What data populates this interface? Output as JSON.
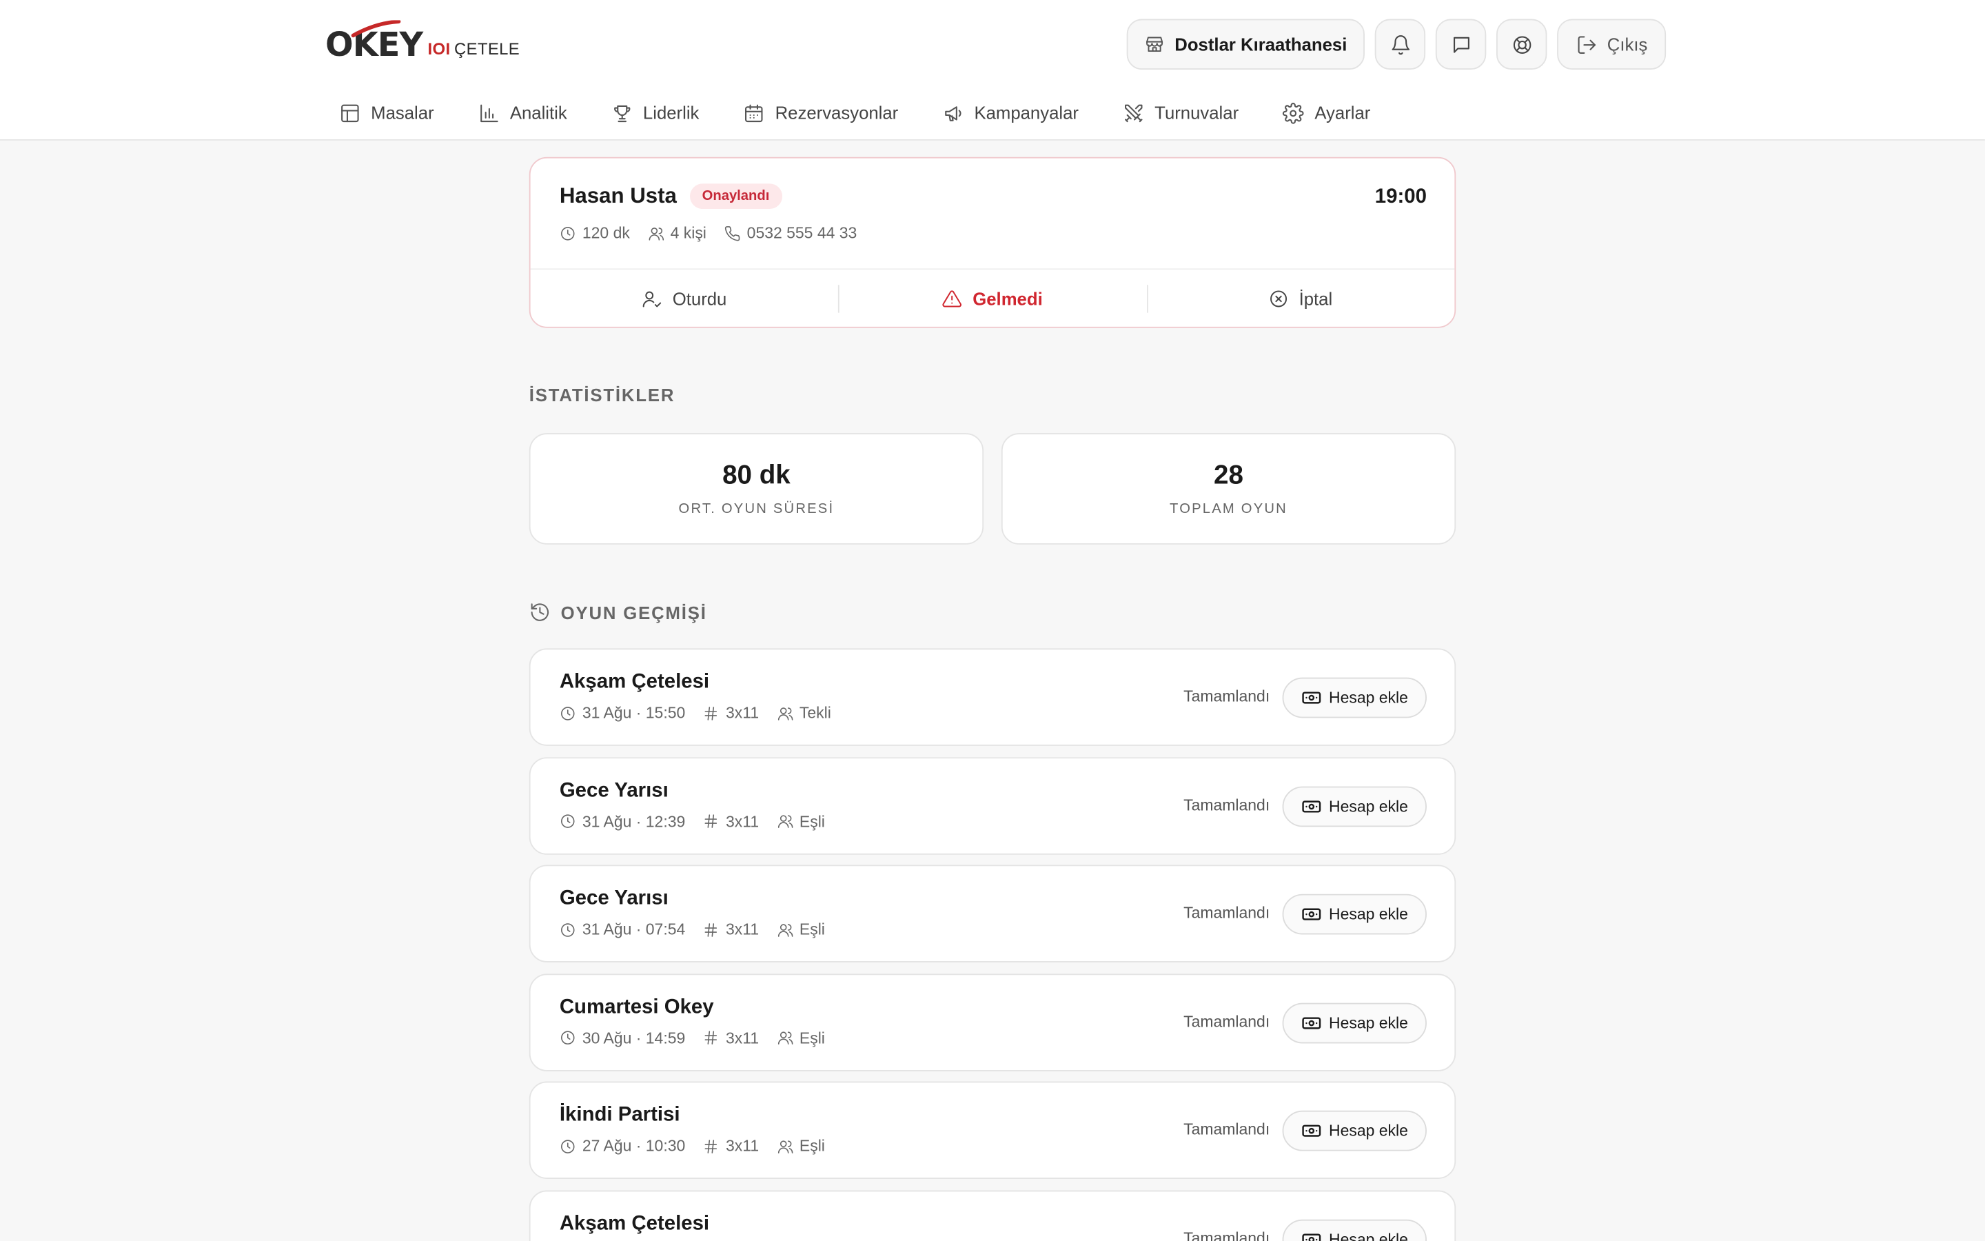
{
  "logo": {
    "main": "OKEY",
    "io": "IOI",
    "sub": "ÇETELE"
  },
  "header": {
    "venue": "Dostlar Kıraathanesi",
    "exit_label": "Çıkış"
  },
  "nav": [
    {
      "label": "Masalar",
      "icon": "table-icon"
    },
    {
      "label": "Analitik",
      "icon": "chart-icon"
    },
    {
      "label": "Liderlik",
      "icon": "trophy-icon"
    },
    {
      "label": "Rezervasyonlar",
      "icon": "calendar-icon"
    },
    {
      "label": "Kampanyalar",
      "icon": "megaphone-icon"
    },
    {
      "label": "Turnuvalar",
      "icon": "swords-icon"
    },
    {
      "label": "Ayarlar",
      "icon": "gear-icon"
    }
  ],
  "reservation": {
    "name": "Hasan Usta",
    "status": "Onaylandı",
    "time": "19:00",
    "duration": "120 dk",
    "people": "4 kişi",
    "phone": "0532 555 44 33",
    "actions": {
      "seated": "Oturdu",
      "noshow": "Gelmedi",
      "cancel": "İptal"
    }
  },
  "stats": {
    "title": "İSTATİSTİKLER",
    "avg_value": "80 dk",
    "avg_label": "ORT. OYUN SÜRESİ",
    "total_value": "28",
    "total_label": "TOPLAM OYUN"
  },
  "history": {
    "title": "OYUN GEÇMİŞİ",
    "button_label": "Hesap ekle",
    "games": [
      {
        "title": "Akşam Çetelesi",
        "date": "31 Ağu · 15:50",
        "format": "3x11",
        "mode": "Tekli",
        "status": "Tamamlandı"
      },
      {
        "title": "Gece Yarısı",
        "date": "31 Ağu · 12:39",
        "format": "3x11",
        "mode": "Eşli",
        "status": "Tamamlandı"
      },
      {
        "title": "Gece Yarısı",
        "date": "31 Ağu · 07:54",
        "format": "3x11",
        "mode": "Eşli",
        "status": "Tamamlandı"
      },
      {
        "title": "Cumartesi Okey",
        "date": "30 Ağu · 14:59",
        "format": "3x11",
        "mode": "Eşli",
        "status": "Tamamlandı"
      },
      {
        "title": "İkindi Partisi",
        "date": "27 Ağu · 10:30",
        "format": "3x11",
        "mode": "Eşli",
        "status": "Tamamlandı"
      },
      {
        "title": "Akşam Çetelesi",
        "date": "",
        "format": "",
        "mode": "",
        "status": "Tamamlandı"
      }
    ]
  },
  "colors": {
    "accent": "#d0262f",
    "badge_bg": "#fde8ea",
    "card_border": "#e4e4e4"
  }
}
